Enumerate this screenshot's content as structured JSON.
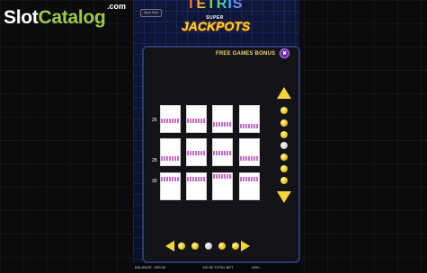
{
  "watermark": {
    "brand_slot": "Slot",
    "brand_catalog": "Catalog",
    "brand_com": ".com"
  },
  "game": {
    "spin_test_label": "Spin Test",
    "logo": {
      "line1": "TETRIS",
      "line2": "SUPER",
      "line3": "JACKPOTS"
    },
    "colors": {
      "accent": "#f6d43b",
      "panel": "#141418",
      "frame": "#2e3a6a",
      "line": "#c264c8"
    }
  },
  "paytable": {
    "title": "FREE GAMES BONUS",
    "close_icon": "close-icon",
    "rows": [
      {
        "label": "25"
      },
      {
        "label": "28"
      },
      {
        "label": "30"
      }
    ],
    "page_count": 5,
    "current_page": 4,
    "side_dot_count": 7,
    "side_dot_active": 3
  },
  "status": {
    "balance": "BALANCE : 990.00",
    "total_bet": "100.00 TOTAL BET",
    "win": "WIN :"
  }
}
